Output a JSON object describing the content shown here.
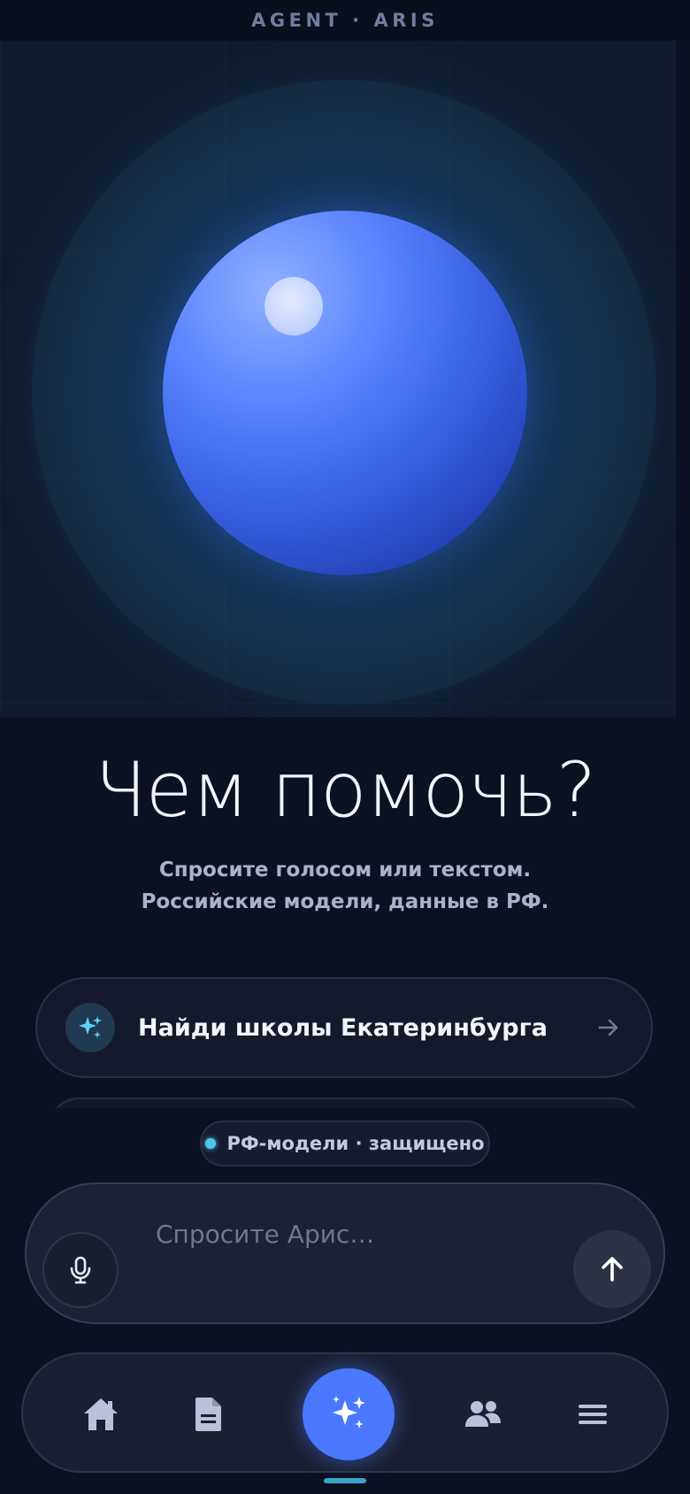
{
  "header": {
    "brand": "AGENT · ARIS"
  },
  "hero": {
    "headline": "Чем помочь?",
    "subtitle": "Спросите голосом или текстом. Российские модели, данные в РФ."
  },
  "suggestions": [
    {
      "label": "Найди школы Екатеринбурга",
      "icon": "sparkles-icon"
    }
  ],
  "status": {
    "label": "РФ-модели · защищено",
    "dot_color": "#4fc8f0"
  },
  "composer": {
    "placeholder": "Спросите Арис…",
    "value": ""
  },
  "nav": {
    "items": [
      {
        "name": "home",
        "icon": "home-icon"
      },
      {
        "name": "documents",
        "icon": "document-icon"
      },
      {
        "name": "assistant",
        "icon": "sparkles-icon",
        "active": true
      },
      {
        "name": "contacts",
        "icon": "users-icon"
      },
      {
        "name": "menu",
        "icon": "menu-icon"
      }
    ]
  },
  "colors": {
    "accent": "#4a78ff",
    "background": "#0c1122",
    "status": "#4fc8f0"
  }
}
